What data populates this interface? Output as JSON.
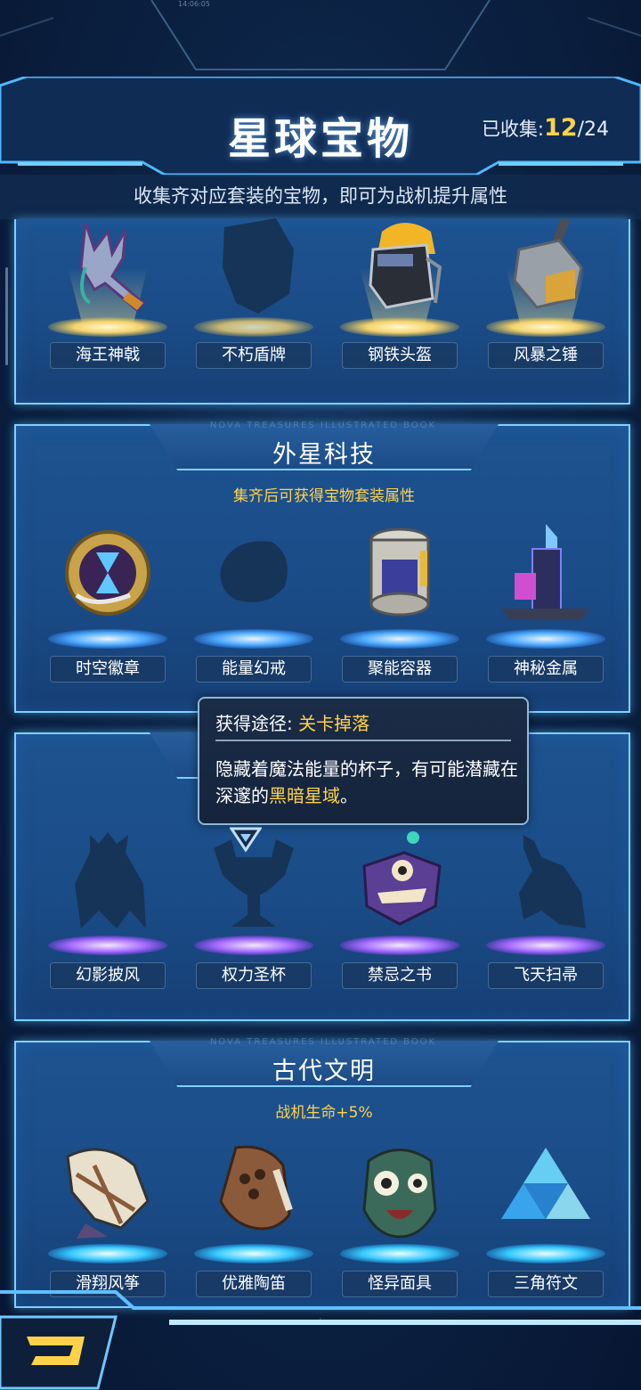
{
  "status_text": "14:06:05",
  "header": {
    "title": "星球宝物",
    "collected_label": "已收集:",
    "collected_count": "12",
    "collected_total": "/24",
    "subtitle": "收集齐对应套装的宝物，即可为战机提升属性"
  },
  "watermark": "NOVA TREASURES ILLUSTRATED BOOK",
  "sets": [
    {
      "name": "",
      "bonus": "",
      "items": [
        {
          "label": "海王神戟",
          "icon": "trident-icon",
          "collected": true
        },
        {
          "label": "不朽盾牌",
          "icon": "shield-silhouette-icon",
          "collected": false
        },
        {
          "label": "钢铁头盔",
          "icon": "welding-helmet-icon",
          "collected": true
        },
        {
          "label": "风暴之锤",
          "icon": "storm-hammer-icon",
          "collected": true
        }
      ]
    },
    {
      "name": "外星科技",
      "bonus": "集齐后可获得宝物套装属性",
      "items": [
        {
          "label": "时空徽章",
          "icon": "hourglass-badge-icon",
          "collected": true
        },
        {
          "label": "能量幻戒",
          "icon": "ring-silhouette-icon",
          "collected": false
        },
        {
          "label": "聚能容器",
          "icon": "energy-container-icon",
          "collected": true
        },
        {
          "label": "神秘金属",
          "icon": "mystic-metal-icon",
          "collected": true
        }
      ]
    },
    {
      "name": "",
      "bonus": "",
      "items": [
        {
          "label": "幻影披风",
          "icon": "cloak-silhouette-icon",
          "collected": false
        },
        {
          "label": "权力圣杯",
          "icon": "chalice-silhouette-icon",
          "collected": false
        },
        {
          "label": "禁忌之书",
          "icon": "forbidden-book-icon",
          "collected": true
        },
        {
          "label": "飞天扫帚",
          "icon": "broom-silhouette-icon",
          "collected": false
        }
      ]
    },
    {
      "name": "古代文明",
      "bonus_prefix": "战机生命+",
      "bonus_value": "5%",
      "items": [
        {
          "label": "滑翔风筝",
          "icon": "glider-kite-icon",
          "collected": true
        },
        {
          "label": "优雅陶笛",
          "icon": "ocarina-icon",
          "collected": true
        },
        {
          "label": "怪异面具",
          "icon": "weird-mask-icon",
          "collected": true
        },
        {
          "label": "三角符文",
          "icon": "triangle-rune-icon",
          "collected": true
        }
      ]
    }
  ],
  "tooltip": {
    "path_label": "获得途径:",
    "path_value": "关卡掉落",
    "desc_part1": "隐藏着魔法能量的杯子，有可能潜藏在深邃的",
    "desc_highlight": "黑暗星域",
    "desc_end": "。"
  },
  "colors": {
    "accent_gold": "#ffd24a",
    "panel_border": "#7fd0ff",
    "silhouette": "#163457"
  }
}
